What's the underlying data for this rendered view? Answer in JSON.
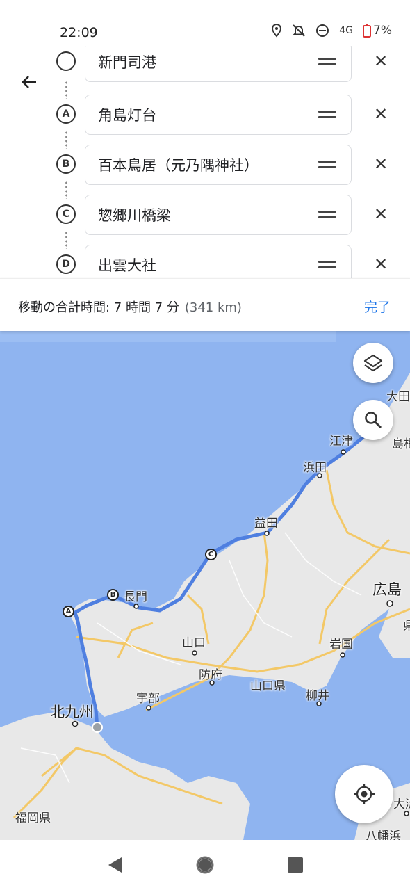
{
  "status": {
    "time": "22:09",
    "network": "4G",
    "battery": "7%"
  },
  "stops": [
    {
      "marker": "",
      "name": "新門司港"
    },
    {
      "marker": "A",
      "name": "角島灯台"
    },
    {
      "marker": "B",
      "name": "百本鳥居（元乃隅神社）"
    },
    {
      "marker": "C",
      "name": "惣郷川橋梁"
    },
    {
      "marker": "D",
      "name": "出雲大社"
    }
  ],
  "summary": {
    "label": "移動の合計時間: 7 時間 7 分",
    "distance": "(341 km)",
    "done": "完了"
  },
  "map": {
    "labels": {
      "oda": "大田",
      "gotsu": "江津",
      "shimane": "島根",
      "hamada": "浜田",
      "masuda": "益田",
      "nagato": "長門",
      "hiroshima": "広島",
      "yamaguchi": "山口",
      "iwakuni": "岩国",
      "hofu": "防府",
      "yamaguchi_pref": "山口県",
      "yanai": "柳井",
      "ube": "宇部",
      "kitakyushu": "北九州",
      "fukuoka_pref": "福岡県",
      "okayama": "県",
      "ozu": "大洲",
      "yawatahama": "八幡浜"
    },
    "pins": {
      "a": "A",
      "b": "B",
      "c": "C"
    },
    "colors": {
      "sea": "#8fb4f0",
      "land": "#e8e8e8",
      "route": "#4f7fe0",
      "roads": "#f3c867"
    }
  }
}
